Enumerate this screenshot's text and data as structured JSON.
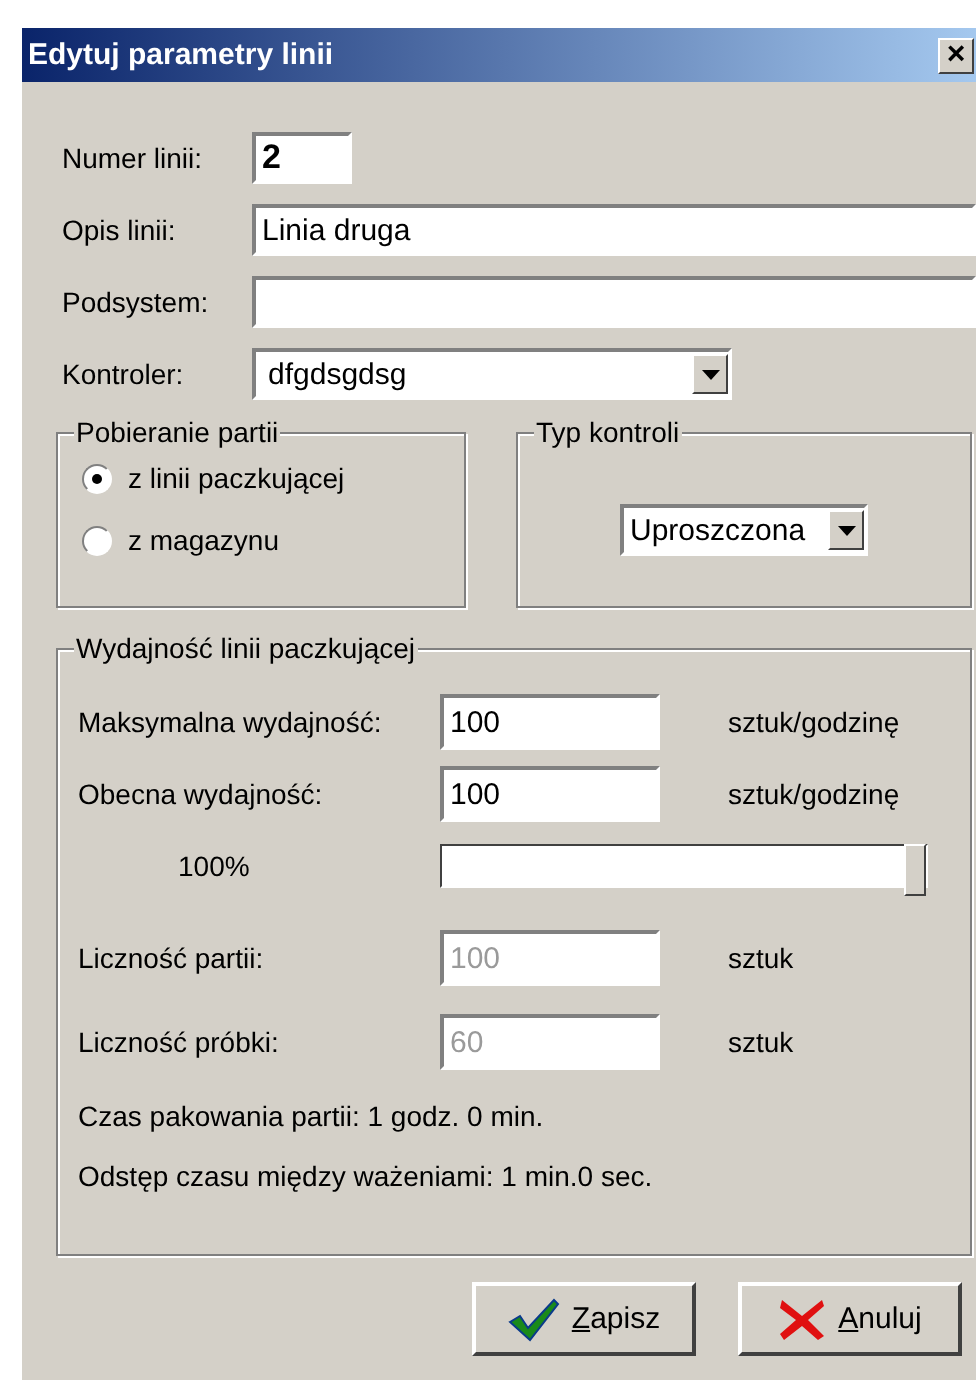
{
  "window": {
    "title": "Edytuj parametry linii",
    "close": "×"
  },
  "fields": [
    {
      "label": "Numer linii:",
      "value": "2",
      "kind": "short"
    },
    {
      "label": "Opis linii:",
      "value": "Linia druga",
      "kind": "wide"
    },
    {
      "label": "Podsystem:",
      "kind": "wide"
    },
    {
      "label": "Kontroler:",
      "value": "dfgdsgdsg",
      "kind": "select"
    }
  ],
  "batch_source": {
    "title": "Pobieranie partii",
    "options": [
      {
        "label": "z linii paczkującej",
        "selected": true
      },
      {
        "label": "z magazynu",
        "selected": false
      }
    ]
  },
  "control_type": {
    "title": "Typ kontroli",
    "value": "Uproszczona"
  },
  "throughput": {
    "title": "Wydajność linii paczkującej",
    "rows": [
      {
        "label": "Maksymalna wydajność:",
        "value": "100",
        "unit": "sztuk/godzinę",
        "disabled": false
      },
      {
        "label": "Obecna wydajność:",
        "value": "100",
        "unit": "sztuk/godzinę",
        "disabled": false
      }
    ],
    "slider": {
      "reading": "100%",
      "level": 1
    },
    "counts": [
      {
        "label": "Liczność partii:",
        "value": "100",
        "unit": "sztuk",
        "disabled": true
      },
      {
        "label": "Liczność próbki:",
        "value": "60",
        "unit": "sztuk",
        "disabled": true
      }
    ],
    "notes": [
      "Czas pakowania partii: 1 godz. 0 min.",
      "Odstęp czasu między ważeniami: 1 min.0 sec."
    ]
  },
  "buttons": [
    {
      "label": "Zapisz",
      "kind": "save"
    },
    {
      "label": "Anuluj",
      "kind": "cancel"
    }
  ]
}
